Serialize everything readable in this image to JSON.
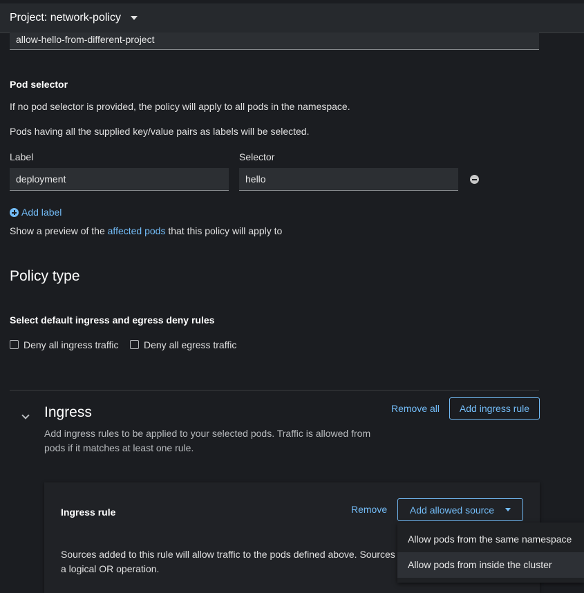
{
  "header": {
    "project_label": "Project: network-policy"
  },
  "policy_name": {
    "value": "allow-hello-from-different-project"
  },
  "pod_selector": {
    "title": "Pod selector",
    "help1": "If no pod selector is provided, the policy will apply to all pods in the namespace.",
    "help2": "Pods having all the supplied key/value pairs as labels will be selected.",
    "label_header": "Label",
    "selector_header": "Selector",
    "label_value": "deployment",
    "selector_value": "hello",
    "add_label": "Add label",
    "preview_prefix": "Show a preview of the ",
    "preview_link": "affected pods",
    "preview_suffix": " that this policy will apply to"
  },
  "policy_type": {
    "title": "Policy type",
    "subtitle": "Select default ingress and egress deny rules",
    "deny_ingress": "Deny all ingress traffic",
    "deny_egress": "Deny all egress traffic"
  },
  "ingress": {
    "title": "Ingress",
    "description_line1": "Add ingress rules to be applied to your selected pods. Traffic is allowed from",
    "description_line2": "pods if it matches at least one rule.",
    "remove_all": "Remove all",
    "add_rule": "Add ingress rule",
    "rule": {
      "title": "Ingress rule",
      "remove": "Remove",
      "add_source": "Add allowed source",
      "text_line1": "Sources added to this rule will allow traffic to the pods defined above. Sources",
      "text_line2": "a logical OR operation."
    },
    "dropdown": {
      "items": [
        "Allow pods from the same namespace",
        "Allow pods from inside the cluster"
      ]
    }
  }
}
